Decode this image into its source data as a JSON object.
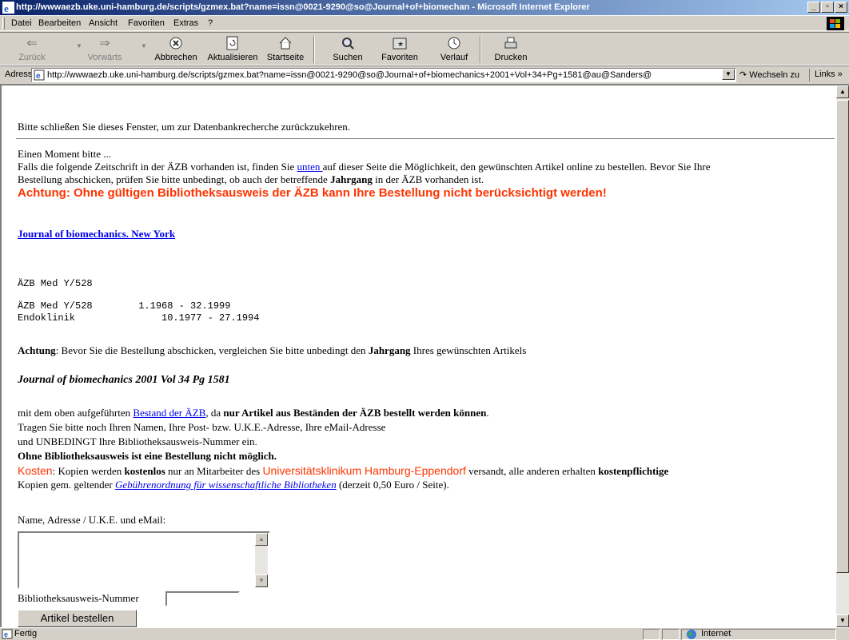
{
  "window": {
    "title": "http://wwwaezb.uke.uni-hamburg.de/scripts/gzmex.bat?name=issn@0021-9290@so@Journal+of+biomechan - Microsoft Internet Explorer"
  },
  "menu": [
    "Datei",
    "Bearbeiten",
    "Ansicht",
    "Favoriten",
    "Extras",
    "?"
  ],
  "toolbar": {
    "back": "Zurück",
    "forward": "Vorwärts",
    "stop": "Abbrechen",
    "refresh": "Aktualisieren",
    "home": "Startseite",
    "search": "Suchen",
    "favorites": "Favoriten",
    "history": "Verlauf",
    "print": "Drucken"
  },
  "address": {
    "label": "Adresse",
    "url": "http://wwwaezb.uke.uni-hamburg.de/scripts/gzmex.bat?name=issn@0021-9290@so@Journal+of+biomechanics+2001+Vol+34+Pg+1581@au@Sanders@",
    "go": "Wechseln zu",
    "links": "Links »"
  },
  "page": {
    "close_hint": "Bitte schließen Sie dieses Fenster, um zur Datenbankrecherche zurückzukehren.",
    "wait": "Einen Moment bitte ...",
    "info_pre": "Falls die folgende Zeitschrift in der ÄZB vorhanden ist, finden Sie ",
    "info_link": "unten ",
    "info_post": "auf dieser Seite die Möglichkeit, den gewünschten Artikel online zu bestellen. Bevor Sie Ihre",
    "info2_pre": "Bestellung abschicken, prüfen Sie bitte unbedingt, ob auch der betreffende ",
    "info2_bold": "Jahrgang",
    "info2_post": " in der ÄZB vorhanden ist.",
    "warning": "Achtung: Ohne gültigen Bibliotheksausweis der ÄZB kann Ihre Bestellung nicht berücksichtigt werden!",
    "journal_link": "Journal of biomechanics. New York",
    "holding1": "ÄZB Med Y/528",
    "holding2": "ÄZB Med Y/528        1.1968 - 32.1999",
    "holding3": "Endoklinik               10.1977 - 27.1994",
    "achtung_bold": "Achtung",
    "achtung_mid": ": Bevor Sie die Bestellung abschicken, vergleichen Sie bitte unbedingt den ",
    "achtung_bold2": "Jahrgang",
    "achtung_post": " Ihres gewünschten Artikels",
    "citation": "Journal of biomechanics 2001 Vol 34 Pg 1581",
    "compare_pre": "mit dem oben aufgeführten ",
    "compare_link": "Bestand der ÄZB",
    "compare_mid": ", da ",
    "compare_bold": "nur Artikel aus Beständen der ÄZB bestellt werden können",
    "compare_post": ".",
    "enter1": "Tragen Sie bitte noch Ihren Namen, Ihre Post- bzw. U.K.E.-Adresse, Ihre eMail-Adresse",
    "enter2": "und UNBEDINGT Ihre Bibliotheksausweis-Nummer ein.",
    "no_card": "Ohne Bibliotheksausweis ist eine Bestellung nicht möglich.",
    "cost_label": "Kosten",
    "cost_mid1": ": Kopien werden ",
    "cost_bold1": "kostenlos",
    "cost_mid2": " nur an Mitarbeiter des ",
    "cost_org": "Universitätsklinikum Hamburg-Eppendorf",
    "cost_mid3": " versandt, alle anderen erhalten ",
    "cost_bold2": "kostenpflichtige",
    "cost2_pre": "Kopien gem. geltender ",
    "cost2_link": "Gebührenordnung für wissenschaftliche Bibliotheken",
    "cost2_post": " (derzeit 0,50 Euro / Seite).",
    "form_label": "Name, Adresse / U.K.E. und eMail:",
    "card_label": "Bibliotheksausweis-Nummer",
    "submit": "Artikel bestellen"
  },
  "status": {
    "text": "Fertig",
    "zone": "Internet"
  }
}
